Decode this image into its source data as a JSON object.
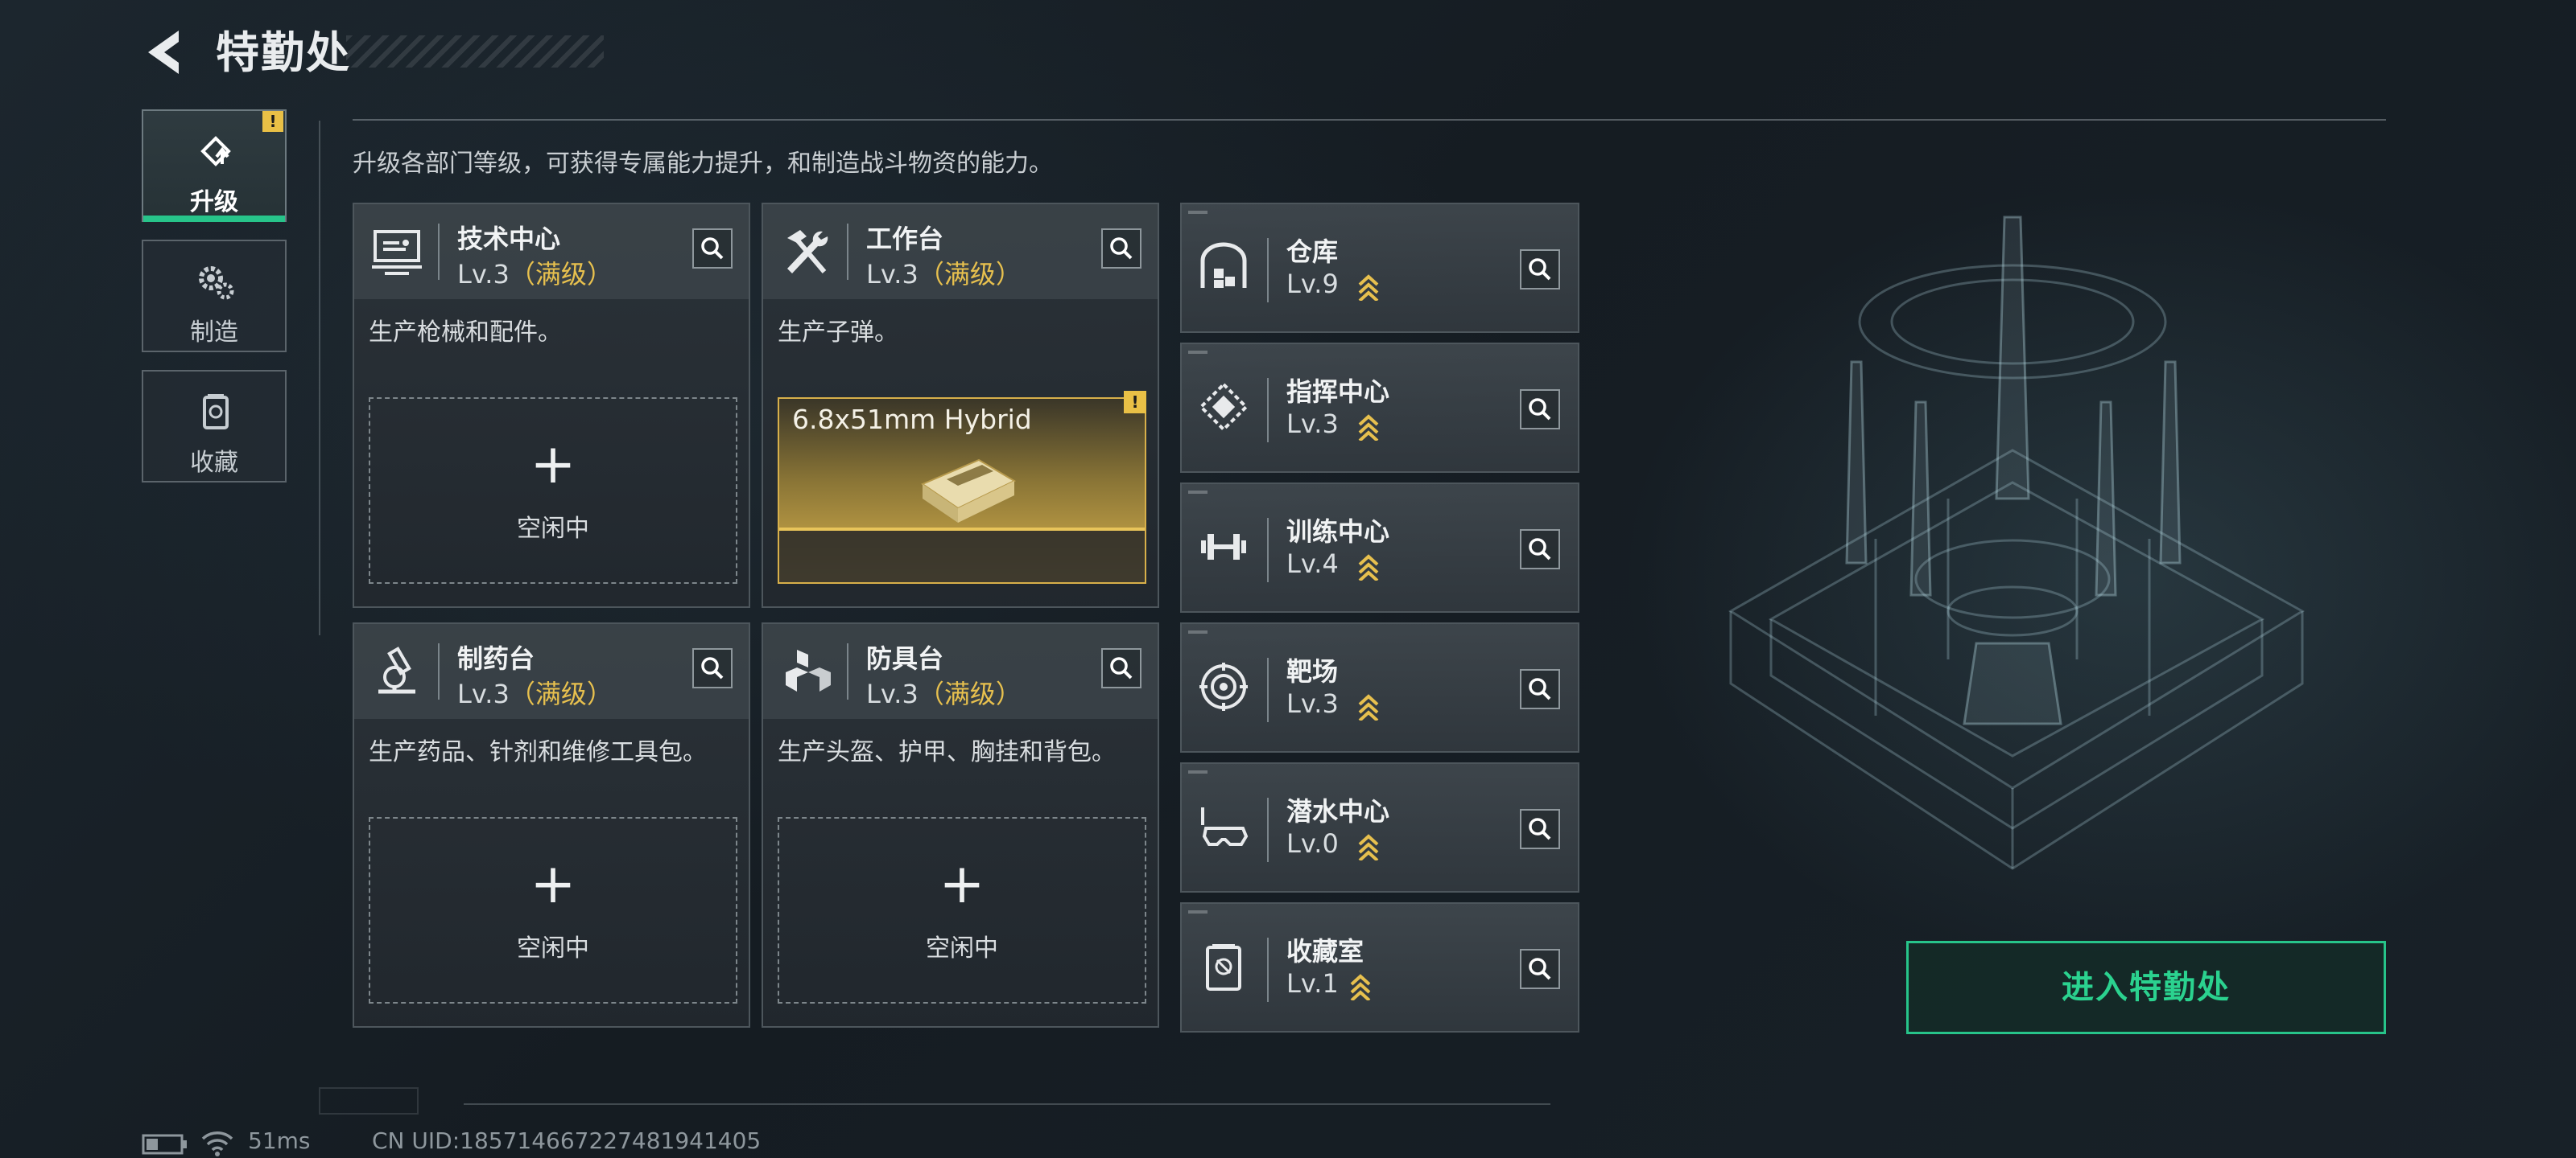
{
  "header": {
    "title": "特勤处"
  },
  "sidebar": {
    "tabs": [
      {
        "label": "升级",
        "icon": "upgrade-icon",
        "active": true,
        "badge": "!"
      },
      {
        "label": "制造",
        "icon": "gears-icon",
        "active": false
      },
      {
        "label": "收藏",
        "icon": "collection-icon",
        "active": false
      }
    ]
  },
  "main": {
    "description": "升级各部门等级，可获得专属能力提升，和制造战斗物资的能力。",
    "production_cards": [
      {
        "name": "技术中心",
        "level": "Lv.3",
        "max": "（满级）",
        "desc": "生产枪械和配件。",
        "slot": {
          "type": "idle",
          "plus": "+",
          "label": "空闲中"
        },
        "icon": "computer-icon"
      },
      {
        "name": "工作台",
        "level": "Lv.3",
        "max": "（满级）",
        "desc": "生产子弹。",
        "slot": {
          "type": "item",
          "item_name": "6.8x51mm Hybrid",
          "badge": "!"
        },
        "icon": "hammer-wrench-icon"
      },
      {
        "name": "制药台",
        "level": "Lv.3",
        "max": "（满级）",
        "desc": "生产药品、针剂和维修工具包。",
        "slot": {
          "type": "idle",
          "plus": "+",
          "label": "空闲中"
        },
        "icon": "microscope-icon"
      },
      {
        "name": "防具台",
        "level": "Lv.3",
        "max": "（满级）",
        "desc": "生产头盔、护甲、胸挂和背包。",
        "slot": {
          "type": "idle",
          "plus": "+",
          "label": "空闲中"
        },
        "icon": "armor-cubes-icon"
      }
    ],
    "facilities": [
      {
        "name": "仓库",
        "level": "Lv.9",
        "icon": "warehouse-icon"
      },
      {
        "name": "指挥中心",
        "level": "Lv.3",
        "icon": "command-icon"
      },
      {
        "name": "训练中心",
        "level": "Lv.4",
        "icon": "dumbbell-icon"
      },
      {
        "name": "靶场",
        "level": "Lv.3",
        "icon": "target-icon"
      },
      {
        "name": "潜水中心",
        "level": "Lv.0",
        "icon": "diving-mask-icon"
      },
      {
        "name": "收藏室",
        "level": "Lv.1",
        "icon": "vault-icon"
      }
    ]
  },
  "enter_button": {
    "label": "进入特勤处"
  },
  "footer": {
    "ping": "51ms",
    "uid": "CN UID:185714667227481941405"
  },
  "colors": {
    "accent_green": "#27c48a",
    "gold": "#e7c04e",
    "warning": "#e9c046"
  }
}
